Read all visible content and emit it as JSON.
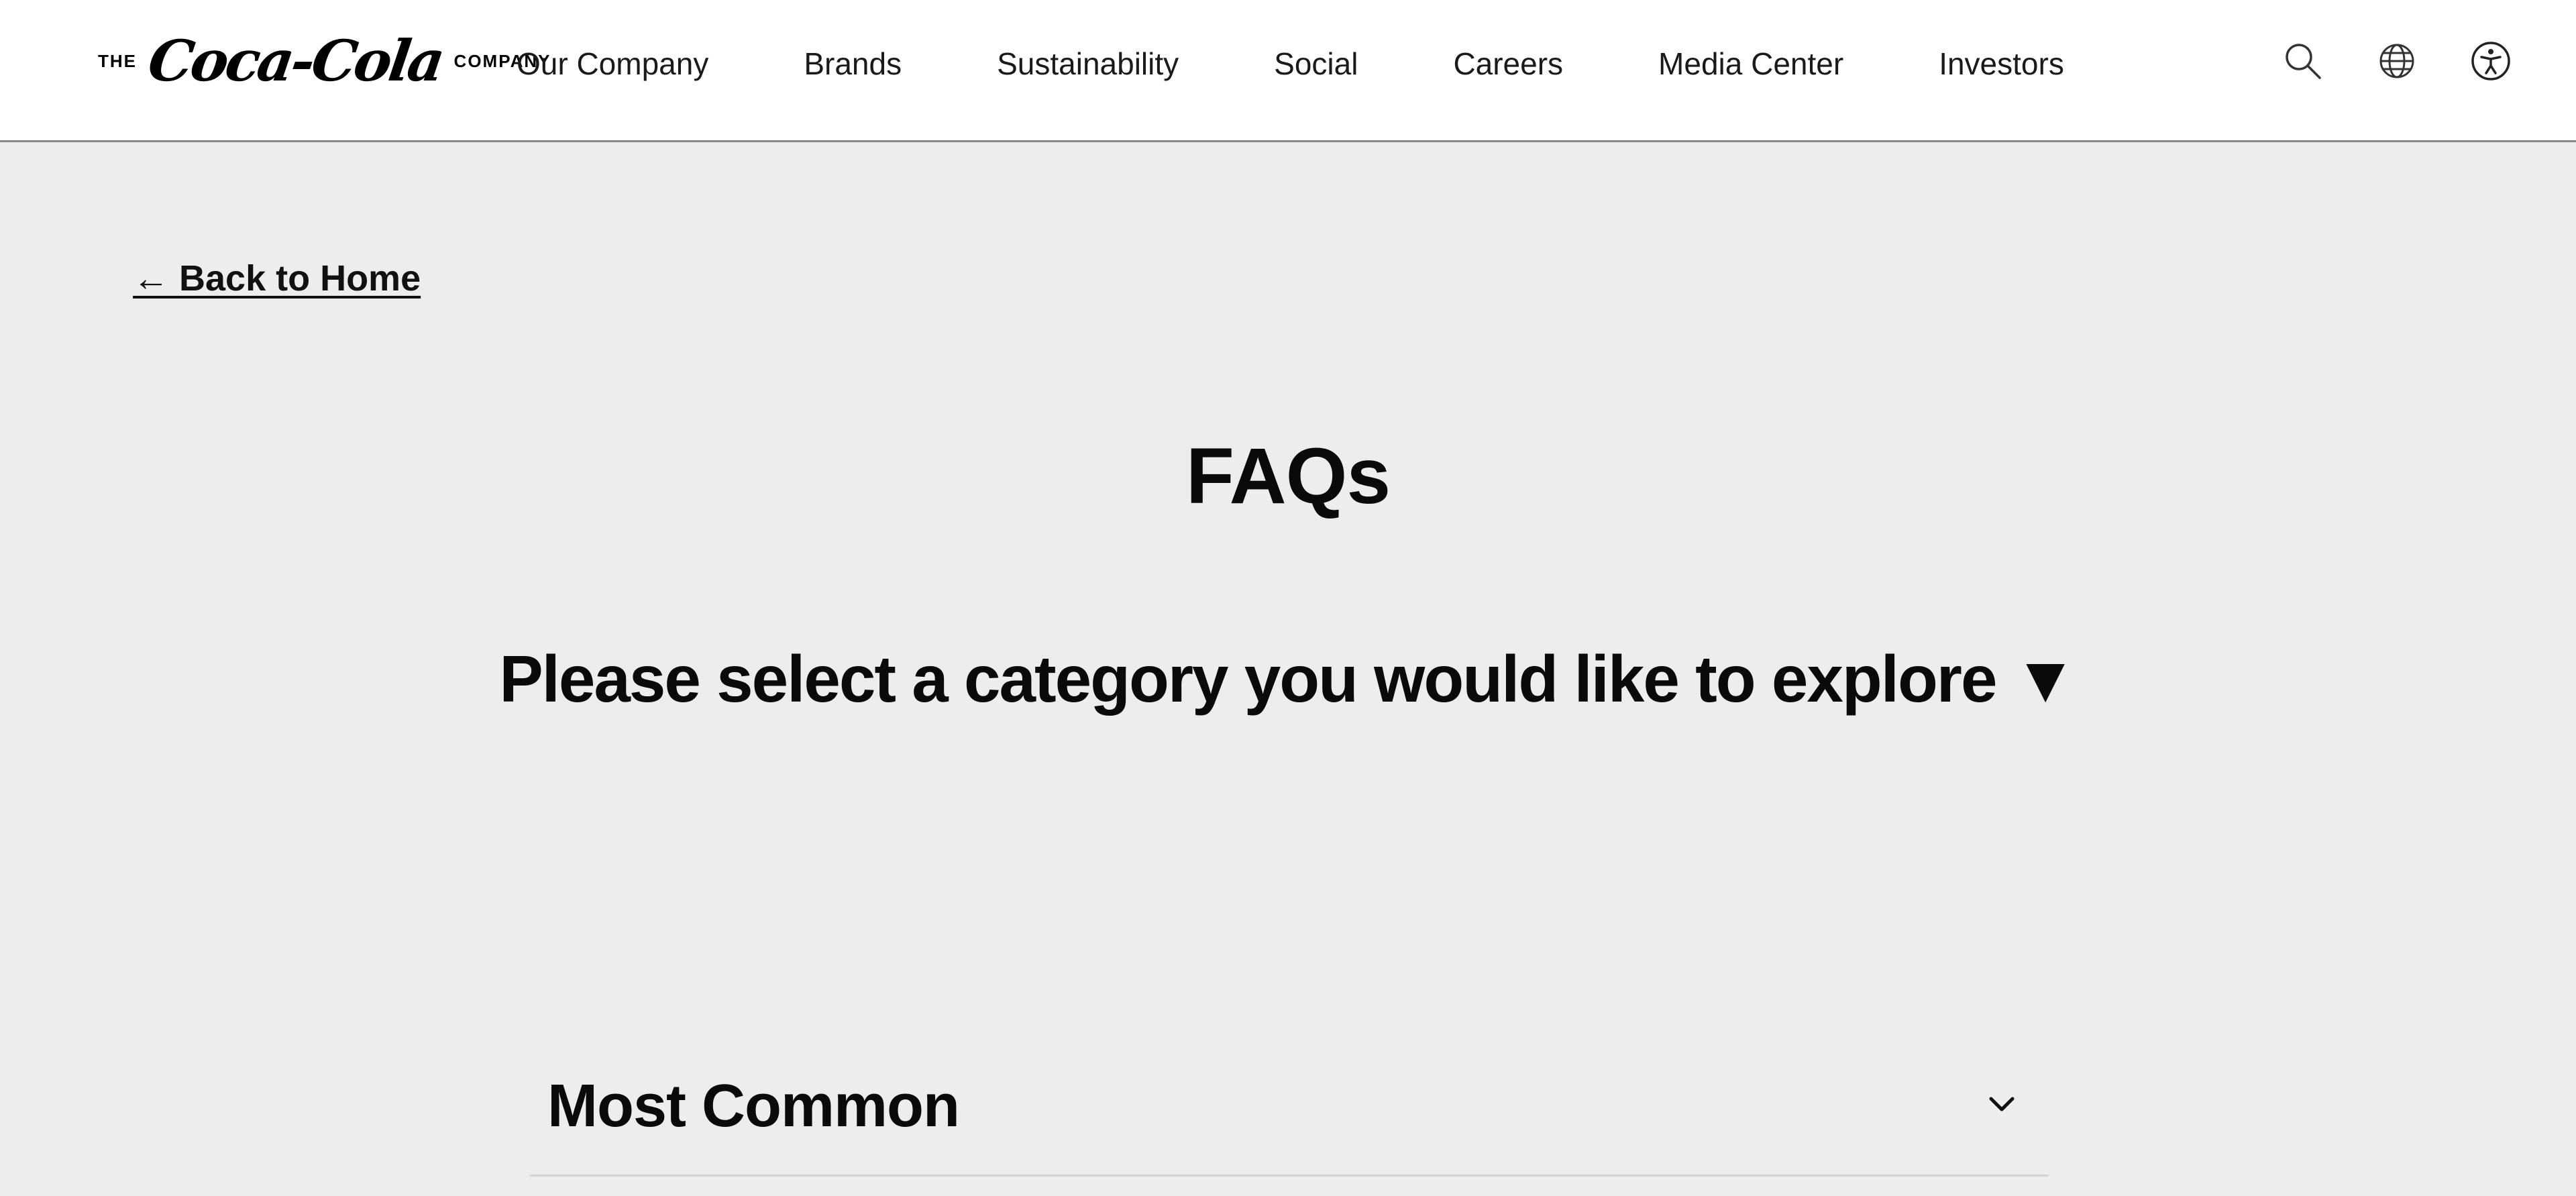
{
  "header": {
    "logo": {
      "prefix": "THE",
      "script": "Coca-Cola",
      "suffix": "COMPANY"
    },
    "nav": [
      {
        "label": "Our Company"
      },
      {
        "label": "Brands"
      },
      {
        "label": "Sustainability"
      },
      {
        "label": "Social"
      },
      {
        "label": "Careers"
      },
      {
        "label": "Media Center"
      },
      {
        "label": "Investors"
      }
    ],
    "icons": [
      "search-icon",
      "globe-icon",
      "accessibility-icon"
    ]
  },
  "main": {
    "back_link": "← Back to Home",
    "title": "FAQs",
    "prompt": "Please select a category you would like to explore ▼",
    "sections": [
      {
        "title": "Most Common",
        "expanded": false
      }
    ]
  },
  "colors": {
    "header_bg": "#ffffff",
    "page_bg": "#ededed",
    "text": "#111111",
    "divider": "#d4d4d4"
  }
}
